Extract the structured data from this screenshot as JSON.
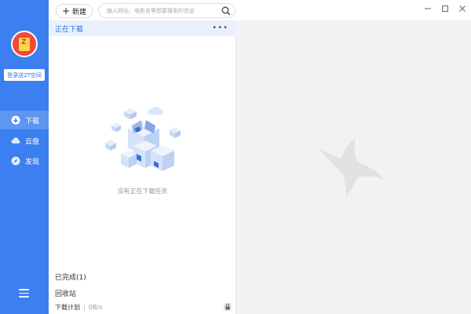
{
  "sidebar": {
    "login_label": "登录送2T空间",
    "items": [
      {
        "label": "下载",
        "icon": "download-icon",
        "active": true
      },
      {
        "label": "云盘",
        "icon": "cloud-icon",
        "active": false
      },
      {
        "label": "发现",
        "icon": "compass-icon",
        "active": false
      }
    ],
    "menu_icon": "hamburger-icon"
  },
  "toolbar": {
    "new_label": "新建",
    "search_placeholder": "输入网址、电影名等想要搜索的信息"
  },
  "panel": {
    "header": "正在下载",
    "empty_message": "没有正在下载任务",
    "completed_label": "已完成(1)",
    "recycle_label": "回收站",
    "plan_label": "下载计划",
    "speed": "0B/s"
  },
  "colors": {
    "accent": "#3b7ff0",
    "header_bg": "#eaf1fd",
    "right_bg": "#f2f2f2"
  }
}
